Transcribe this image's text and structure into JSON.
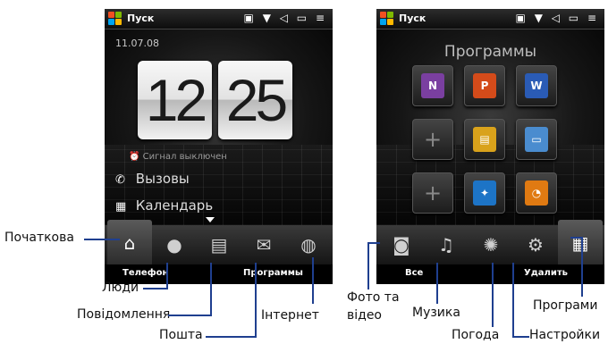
{
  "screen_home": {
    "status_title": "Пуск",
    "status_icons": "▣ ▼ ◁ ▭ ≡",
    "date": "11.07.08",
    "hours": "12",
    "minutes": "25",
    "alarm_text": "Сигнал выключен",
    "calls_label": "Вызовы",
    "calendar_label": "Календарь",
    "softkey_left": "Телефон",
    "softkey_right": "Программы"
  },
  "screen_programs": {
    "status_title": "Пуск",
    "status_icons": "▣ ▼ ◁ ▭ ≡",
    "title": "Программы",
    "tiles": [
      {
        "icon": "onenote-icon",
        "glyph": "N",
        "color": "#7a3fa0"
      },
      {
        "icon": "powerpoint-icon",
        "glyph": "P",
        "color": "#d44b1a"
      },
      {
        "icon": "word-icon",
        "glyph": "W",
        "color": "#2a5bb5"
      },
      {
        "icon": "plus-icon",
        "glyph": "+",
        "color": ""
      },
      {
        "icon": "file-explorer-icon",
        "glyph": "▤",
        "color": "#d9a21b"
      },
      {
        "icon": "remote-desktop-icon",
        "glyph": "▭",
        "color": "#4a8ccf"
      },
      {
        "icon": "plus-icon",
        "glyph": "+",
        "color": ""
      },
      {
        "icon": "browser-compass-icon",
        "glyph": "✦",
        "color": "#1d74c6"
      },
      {
        "icon": "rss-icon",
        "glyph": "◔",
        "color": "#e07a12"
      }
    ],
    "softkey_left": "Все",
    "softkey_right": "Удалить"
  },
  "tabs_home": [
    {
      "name": "home-icon",
      "glyph": "⌂"
    },
    {
      "name": "people-icon",
      "glyph": "●"
    },
    {
      "name": "messages-icon",
      "glyph": "▤"
    },
    {
      "name": "mail-icon",
      "glyph": "✉"
    },
    {
      "name": "internet-icon",
      "glyph": "◍"
    }
  ],
  "tabs_programs": [
    {
      "name": "camera-icon",
      "glyph": "◙"
    },
    {
      "name": "music-icon",
      "glyph": "♫"
    },
    {
      "name": "weather-icon",
      "glyph": "✺"
    },
    {
      "name": "settings-icon",
      "glyph": "⚙"
    },
    {
      "name": "programs-grid-icon",
      "glyph": "▦"
    }
  ],
  "callouts": {
    "home": "Початкова",
    "people": "Люди",
    "messages": "Повідомлення",
    "mail": "Пошта",
    "internet": "Інтернет",
    "photo_line1": "Фото та",
    "photo_line2": "відео",
    "music": "Музика",
    "weather": "Погода",
    "programs": "Програми",
    "settings": "Настройки"
  }
}
